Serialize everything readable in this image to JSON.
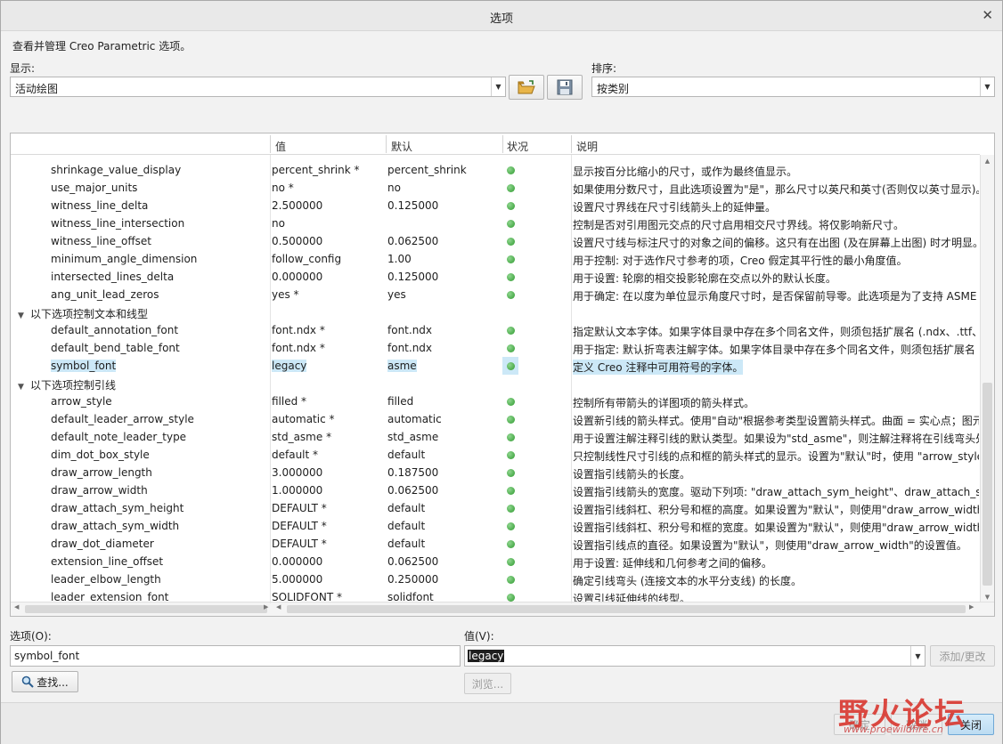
{
  "window": {
    "title": "选项"
  },
  "description": "查看并管理 Creo Parametric 选项。",
  "display": {
    "label": "显示:",
    "value": "活动绘图"
  },
  "sort": {
    "label": "排序:",
    "value": "按类别"
  },
  "table": {
    "headers": {
      "name": "",
      "value": "值",
      "default": "默认",
      "status": "状况",
      "description": "说明"
    },
    "rows": [
      {
        "kind": "option",
        "name": "shrinkage_value_display",
        "value": "percent_shrink *",
        "default": "percent_shrink",
        "desc": "显示按百分比缩小的尺寸，或作为最终值显示。"
      },
      {
        "kind": "option",
        "name": "use_major_units",
        "value": "no *",
        "default": "no",
        "desc": "如果使用分数尺寸，且此选项设置为\"是\"，那么尺寸以英尺和英寸(否则仅以英寸显示)。"
      },
      {
        "kind": "option",
        "name": "witness_line_delta",
        "value": "2.500000",
        "default": "0.125000",
        "desc": "设置尺寸界线在尺寸引线箭头上的延伸量。"
      },
      {
        "kind": "option",
        "name": "witness_line_intersection",
        "value": "no",
        "default": "",
        "desc": "控制是否对引用图元交点的尺寸启用相交尺寸界线。将仅影响新尺寸。"
      },
      {
        "kind": "option",
        "name": "witness_line_offset",
        "value": "0.500000",
        "default": "0.062500",
        "desc": "设置尺寸线与标注尺寸的对象之间的偏移。这只有在出图 (及在屏幕上出图) 时才明显。"
      },
      {
        "kind": "option",
        "name": "minimum_angle_dimension",
        "value": "follow_config",
        "default": "1.00",
        "desc": "用于控制: 对于选作尺寸参考的项，Creo 假定其平行性的最小角度值。"
      },
      {
        "kind": "option",
        "name": "intersected_lines_delta",
        "value": "0.000000",
        "default": "0.125000",
        "desc": "用于设置: 轮廓的相交投影轮廓在交点以外的默认长度。"
      },
      {
        "kind": "option",
        "name": "ang_unit_lead_zeros",
        "value": "yes *",
        "default": "yes",
        "desc": "用于确定: 在以度为单位显示角度尺寸时，是否保留前导零。此选项是为了支持 ASME 标准。"
      },
      {
        "kind": "group",
        "name": "以下选项控制文本和线型"
      },
      {
        "kind": "option",
        "name": "default_annotation_font",
        "value": "font.ndx *",
        "default": "font.ndx",
        "desc": "指定默认文本字体。如果字体目录中存在多个同名文件，则须包括扩展名 (.ndx、.ttf、.pfa)。"
      },
      {
        "kind": "option",
        "name": "default_bend_table_font",
        "value": "font.ndx *",
        "default": "font.ndx",
        "desc": "用于指定: 默认折弯表注解字体。如果字体目录中存在多个同名文件，则须包括扩展名 (.ndx)。"
      },
      {
        "kind": "option",
        "name": "symbol_font",
        "value": "legacy",
        "default": "asme",
        "desc": "定义 Creo 注释中可用符号的字体。",
        "selected": true
      },
      {
        "kind": "group",
        "name": "以下选项控制引线"
      },
      {
        "kind": "option",
        "name": "arrow_style",
        "value": "filled *",
        "default": "filled",
        "desc": "控制所有带箭头的详图项的箭头样式。"
      },
      {
        "kind": "option",
        "name": "default_leader_arrow_style",
        "value": "automatic *",
        "default": "automatic",
        "desc": "设置新引线的箭头样式。使用\"自动\"根据参考类型设置箭头样式。曲面 = 实心点；图元 = 箭头。"
      },
      {
        "kind": "option",
        "name": "default_note_leader_type",
        "value": "std_asme *",
        "default": "std_asme",
        "desc": "用于设置注解注释引线的默认类型。如果设为\"std_asme\"，则注解注释将在引线弯头处附着。"
      },
      {
        "kind": "option",
        "name": "dim_dot_box_style",
        "value": "default *",
        "default": "default",
        "desc": "只控制线性尺寸引线的点和框的箭头样式的显示。设置为\"默认\"时，使用 \"arrow_style\"。"
      },
      {
        "kind": "option",
        "name": "draw_arrow_length",
        "value": "3.000000",
        "default": "0.187500",
        "desc": "设置指引线箭头的长度。"
      },
      {
        "kind": "option",
        "name": "draw_arrow_width",
        "value": "1.000000",
        "default": "0.062500",
        "desc": "设置指引线箭头的宽度。驱动下列项: \"draw_attach_sym_height\"、draw_attach_sym_width\"。"
      },
      {
        "kind": "option",
        "name": "draw_attach_sym_height",
        "value": "DEFAULT *",
        "default": "default",
        "desc": "设置指引线斜杠、积分号和框的高度。如果设置为\"默认\"，则使用\"draw_arrow_width\"的设置值。"
      },
      {
        "kind": "option",
        "name": "draw_attach_sym_width",
        "value": "DEFAULT *",
        "default": "default",
        "desc": "设置指引线斜杠、积分号和框的宽度。如果设置为\"默认\"，则使用\"draw_arrow_width\"的设置值。"
      },
      {
        "kind": "option",
        "name": "draw_dot_diameter",
        "value": "DEFAULT *",
        "default": "default",
        "desc": "设置指引线点的直径。如果设置为\"默认\"，则使用\"draw_arrow_width\"的设置值。"
      },
      {
        "kind": "option",
        "name": "extension_line_offset",
        "value": "0.000000",
        "default": "0.062500",
        "desc": "用于设置: 延伸线和几何参考之间的偏移。"
      },
      {
        "kind": "option",
        "name": "leader_elbow_length",
        "value": "5.000000",
        "default": "0.250000",
        "desc": "确定引线弯头 (连接文本的水平分支线) 的长度。"
      },
      {
        "kind": "option",
        "name": "leader_extension_font",
        "value": "SOLIDFONT *",
        "default": "solidfont",
        "desc": "设置引线延伸线的线型。"
      }
    ]
  },
  "option_field": {
    "label": "选项(O):",
    "value": "symbol_font"
  },
  "value_field": {
    "label": "值(V):",
    "value": "legacy"
  },
  "buttons": {
    "find": "查找...",
    "add_change": "添加/更改",
    "browse": "浏览...",
    "ok": "确定",
    "cancel": "取消",
    "close": "关闭"
  },
  "watermark": {
    "text": "野火论坛",
    "url": "www.proewildfire.cn"
  },
  "colors": {
    "status_ok": "#2f9a2f",
    "selection": "#cce8f7"
  }
}
